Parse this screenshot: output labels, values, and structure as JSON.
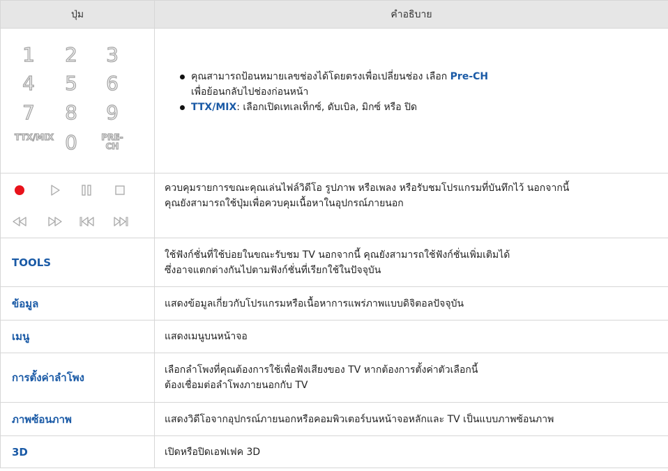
{
  "header": {
    "col_button": "ปุ่ม",
    "col_description": "คำอธิบาย"
  },
  "keypad": {
    "keys": [
      "1",
      "2",
      "3",
      "4",
      "5",
      "6",
      "7",
      "8",
      "9",
      "TTX/MIX",
      "0",
      "PRE-CH"
    ],
    "bullet1_text": "คุณสามารถป้อนหมายเลขช่องได้โดยตรงเพื่อเปลี่ยนช่อง เลือก ",
    "bullet1_highlight": "Pre-CH",
    "bullet1_text2": "เพื่อย้อนกลับไปช่องก่อนหน้า",
    "bullet2_highlight": "TTX/MIX",
    "bullet2_text": ": เลือกเปิดเทเลเท็กซ์, ดับเบิล, มิกซ์ หรือ ปิด"
  },
  "media": {
    "icons": [
      "record-icon",
      "play-icon",
      "pause-icon",
      "stop-icon",
      "rewind-icon",
      "fast-forward-icon",
      "previous-icon",
      "next-icon"
    ],
    "description_line1": "ควบคุมรายการขณะคุณเล่นไฟล์วิดีโอ รูปภาพ หรือเพลง หรือรับชมโปรแกรมที่บันทึกไว้ นอกจากนี้",
    "description_line2": "คุณยังสามารถใช้ปุ่มเพื่อควบคุมเนื้อหาในอุปกรณ์ภายนอก",
    "colors": {
      "record": "#e8121b",
      "icon_gray": "#a8a8a8"
    }
  },
  "rows": [
    {
      "name": "TOOLS",
      "line1": "ใช้ฟังก์ชั่นที่ใช้บ่อยในขณะรับชม TV นอกจากนี้ คุณยังสามารถใช้ฟังก์ชั่นเพิ่มเติมได้",
      "line2": "ซึ่งอาจแตกต่างกันไปตามฟังก์ชั่นที่เรียกใช้ในปัจจุบัน"
    },
    {
      "name": "ข้อมูล",
      "line1": "แสดงข้อมูลเกี่ยวกับโปรแกรมหรือเนื้อหาการแพร่ภาพแบบดิจิตอลปัจจุบัน",
      "line2": ""
    },
    {
      "name": "เมนู",
      "line1": "แสดงเมนูบนหน้าจอ",
      "line2": ""
    },
    {
      "name": "การตั้งค่าลำโพง",
      "line1": "เลือกลำโพงที่คุณต้องการใช้เพื่อฟังเสียงของ TV หากต้องการตั้งค่าตัวเลือกนี้",
      "line2": "ต้องเชื่อมต่อลำโพงภายนอกกับ TV"
    },
    {
      "name": "ภาพซ้อนภาพ",
      "line1": "แสดงวิดีโอจากอุปกรณ์ภายนอกหรือคอมพิวเตอร์บนหน้าจอหลักและ TV เป็นแบบภาพซ้อนภาพ",
      "line2": ""
    },
    {
      "name": "3D",
      "line1": "เปิดหรือปิดเอฟเฟค 3D",
      "line2": ""
    }
  ],
  "colors": {
    "accent": "#1a5aa6",
    "header_bg": "#e6e6e6",
    "border": "#d6d6d6"
  }
}
